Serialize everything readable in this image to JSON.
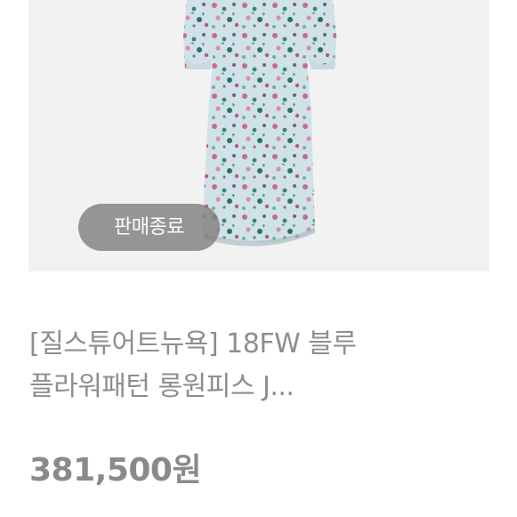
{
  "product": {
    "status_badge": "판매종료",
    "title": "[질스튜어트뉴욕] 18FW 블루 플라워패턴 롱원피스 J...",
    "price": "381,500원"
  }
}
